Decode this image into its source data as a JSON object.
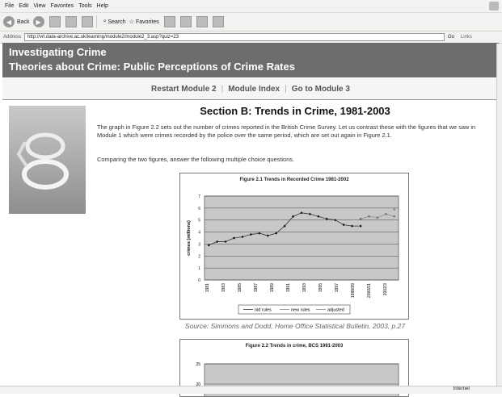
{
  "browser": {
    "menu": [
      "File",
      "Edit",
      "View",
      "Favorites",
      "Tools",
      "Help"
    ],
    "toolbar": {
      "back": "Back",
      "search": "Search",
      "favorites": "Favorites"
    },
    "address_label": "Address",
    "url": "http://vrl.data-archive.ac.uk/learning/module2/module2_3.asp?quiz=23",
    "go": "Go",
    "links": "Links",
    "status_zone": "Internet"
  },
  "page": {
    "title1": "Investigating Crime",
    "title2": "Theories about Crime: Public Perceptions of Crime Rates",
    "nav": [
      "Restart Module 2",
      "Module Index",
      "Go to Module 3"
    ],
    "heading": "Section B: Trends in Crime, 1981-2003",
    "para1": "The graph in Figure 2.2 sets out the number of crimes reported in the British Crime Survey. Let us contrast these with the figures that we saw in Module 1 which were crimes recorded by the police over the same period, which are set out again in Figure 2.1.",
    "para2": "Comparing the two figures, answer the following multiple choice questions.",
    "source": "Source: Simmons and Dodd, Home Office Statistical Bulletin, 2003, p.27"
  },
  "figure2_title": "Figure 2.2 Trends in crime, BCS 1981-2003",
  "chart_data": {
    "type": "line",
    "title": "Figure 2.1 Trends in Recorded Crime 1981-2002",
    "ylabel": "crimes (millions)",
    "ylim": [
      0,
      7
    ],
    "yticks": [
      0,
      1,
      2,
      3,
      4,
      5,
      6,
      7
    ],
    "xticks": [
      "1981",
      "1983",
      "1985",
      "1987",
      "1989",
      "1991",
      "1993",
      "1995",
      "1997",
      "1998/99",
      "2000/01",
      "2002/3"
    ],
    "x": [
      "1981",
      "1982",
      "1983",
      "1984",
      "1985",
      "1986",
      "1987",
      "1988",
      "1989",
      "1990",
      "1991",
      "1992",
      "1993",
      "1994",
      "1995",
      "1996",
      "1997",
      "1998",
      "1998/99",
      "1999/00",
      "2000/01",
      "2001/02",
      "2002/3"
    ],
    "series": [
      {
        "name": "old rules",
        "values": [
          2.9,
          3.2,
          3.2,
          3.5,
          3.6,
          3.8,
          3.9,
          3.7,
          3.9,
          4.5,
          5.3,
          5.6,
          5.5,
          5.3,
          5.1,
          5.0,
          4.6,
          4.5,
          4.5,
          null,
          null,
          null,
          null
        ]
      },
      {
        "name": "new rules",
        "values": [
          null,
          null,
          null,
          null,
          null,
          null,
          null,
          null,
          null,
          null,
          null,
          null,
          null,
          null,
          null,
          null,
          null,
          null,
          5.1,
          5.3,
          5.2,
          5.5,
          5.3
        ]
      },
      {
        "name": "adjusted",
        "values": [
          null,
          null,
          null,
          null,
          null,
          null,
          null,
          null,
          null,
          null,
          null,
          null,
          null,
          null,
          null,
          null,
          null,
          null,
          null,
          null,
          null,
          null,
          5.9
        ]
      }
    ],
    "colors": {
      "plot_bg": "#c8c8c8",
      "line": "#333333",
      "new_rules": "#888888"
    }
  },
  "chart2_data": {
    "type": "line",
    "yticks": [
      20,
      25
    ],
    "ylim": [
      15,
      25
    ],
    "partial_values": [
      {
        "x": 0.55,
        "y": 19.3
      },
      {
        "x": 0.66,
        "y": 19.3
      }
    ]
  }
}
